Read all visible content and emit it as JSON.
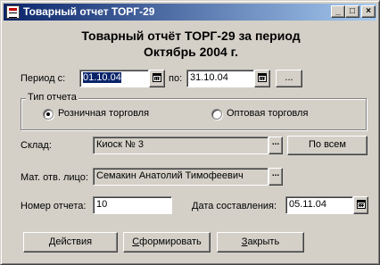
{
  "window": {
    "title": "Товарный отчет ТОРГ-29",
    "caption_buttons": {
      "minimize": "_",
      "maximize": "□",
      "close": "×"
    }
  },
  "heading": {
    "line1": "Товарный отчёт ТОРГ-29 за период",
    "line2": "Октябрь 2004 г."
  },
  "period": {
    "label": "Период с:",
    "from": "01.10.04",
    "to_label": "по:",
    "to": "31.10.04",
    "more_button": "..."
  },
  "report_type": {
    "legend": "Тип отчета",
    "options": [
      {
        "label": "Розничная торговля",
        "checked": true
      },
      {
        "label": "Оптовая торговля",
        "checked": false
      }
    ]
  },
  "warehouse": {
    "label": "Склад:",
    "value": "Киоск № 3",
    "select_button": "...",
    "all_button": "По всем"
  },
  "responsible": {
    "label": "Мат. отв. лицо:",
    "value": "Семакин Анатолий Тимофеевич",
    "select_button": "..."
  },
  "report_number": {
    "label": "Номер отчета:",
    "value": "10"
  },
  "compose_date": {
    "label": "Дата составления:",
    "value": "05.11.04"
  },
  "buttons": {
    "actions": {
      "acc": "Д",
      "rest": "ействия"
    },
    "form": {
      "acc": "С",
      "rest": "формировать"
    },
    "close": {
      "acc": "З",
      "rest": "акрыть"
    }
  },
  "icons": {
    "window": "report-window-icon",
    "date_picker": "calendar-icon"
  }
}
